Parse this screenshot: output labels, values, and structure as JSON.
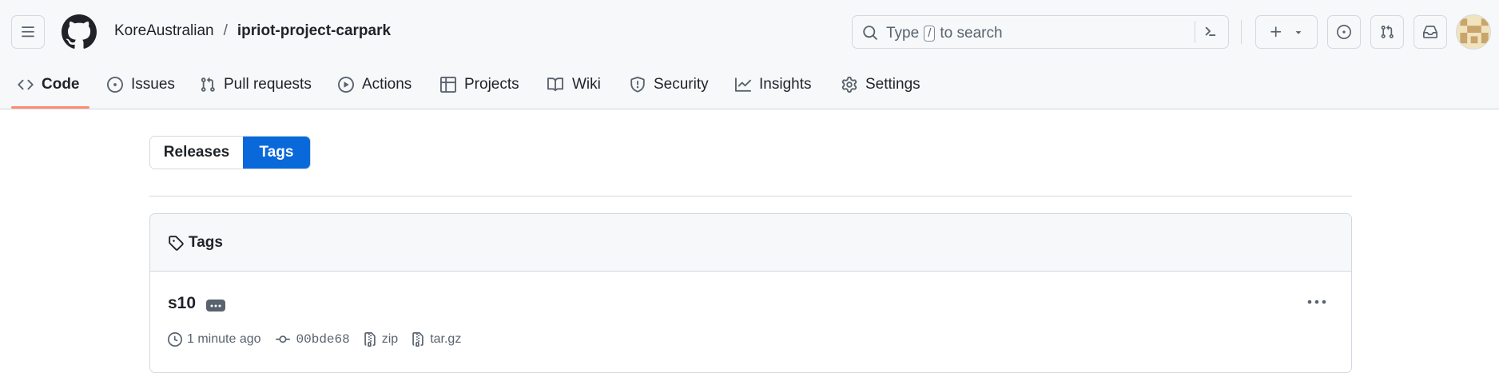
{
  "header": {
    "owner": "KoreAustralian",
    "separator": "/",
    "repo": "ipriot-project-carpark",
    "search": {
      "prefix": "Type",
      "key": "/",
      "suffix": "to search"
    }
  },
  "tabs": [
    {
      "label": "Code",
      "icon": "code-icon",
      "selected": true
    },
    {
      "label": "Issues",
      "icon": "issue-opened-icon"
    },
    {
      "label": "Pull requests",
      "icon": "git-pull-request-icon"
    },
    {
      "label": "Actions",
      "icon": "play-icon"
    },
    {
      "label": "Projects",
      "icon": "table-icon"
    },
    {
      "label": "Wiki",
      "icon": "book-icon"
    },
    {
      "label": "Security",
      "icon": "shield-icon"
    },
    {
      "label": "Insights",
      "icon": "graph-icon"
    },
    {
      "label": "Settings",
      "icon": "gear-icon"
    }
  ],
  "segmented": {
    "releases": "Releases",
    "tags": "Tags",
    "selected": "Tags"
  },
  "tags_box": {
    "title": "Tags",
    "items": [
      {
        "name": "s10",
        "time": "1 minute ago",
        "commit": "00bde68",
        "zip": "zip",
        "targz": "tar.gz"
      }
    ]
  },
  "colors": {
    "accent": "#0969da",
    "underline": "#fd8c73",
    "border": "#d1d9e0",
    "muted": "#59636e"
  }
}
